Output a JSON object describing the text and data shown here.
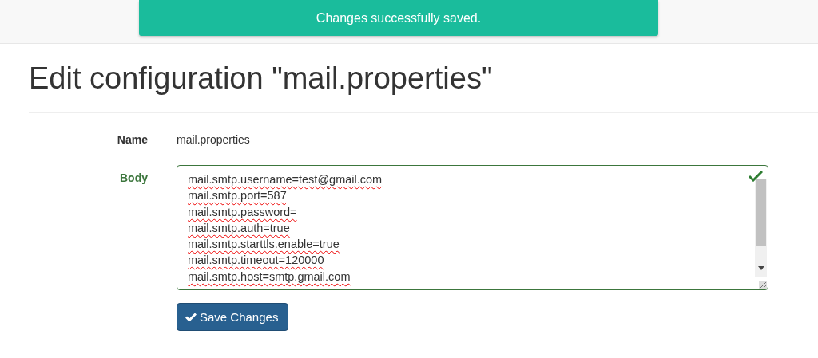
{
  "notification": {
    "text": "Changes successfully saved."
  },
  "page_title": "Edit configuration \"mail.properties\"",
  "form": {
    "name": {
      "label": "Name",
      "value": "mail.properties"
    },
    "body": {
      "label": "Body",
      "valid": true,
      "lines": [
        "mail.smtp.username=test@gmail.com",
        "mail.smtp.port=587",
        "mail.smtp.password=",
        "mail.smtp.auth=true",
        "mail.smtp.starttls.enable=true",
        "mail.smtp.timeout=120000",
        "mail.smtp.host=smtp.gmail.com"
      ]
    },
    "save_button": "Save Changes"
  }
}
